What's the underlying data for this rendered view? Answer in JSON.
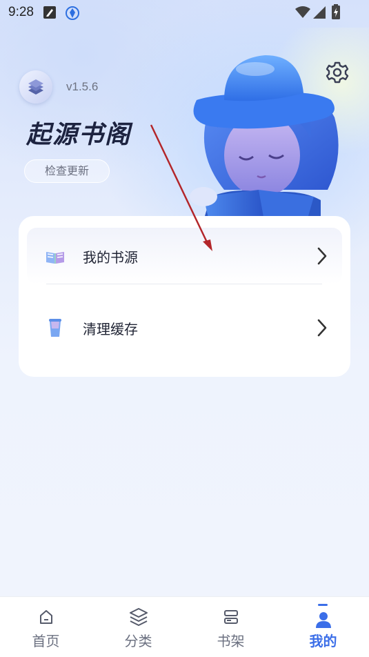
{
  "status_bar": {
    "time": "9:28",
    "icons": [
      "edit-note-icon",
      "security-shield-icon",
      "wifi-icon",
      "signal-icon",
      "battery-charging-icon"
    ]
  },
  "header": {
    "logo_icon": "books-stack-icon",
    "version": "v1.5.6",
    "app_title": "起源书阁",
    "update_button": "检查更新",
    "settings_icon": "gear-icon",
    "mascot": "reading-character-illustration"
  },
  "menu": {
    "items": [
      {
        "label": "我的书源",
        "icon": "open-book-icon"
      },
      {
        "label": "清理缓存",
        "icon": "trash-bin-icon"
      }
    ]
  },
  "nav": {
    "items": [
      {
        "label": "首页",
        "icon": "home-icon",
        "active": false
      },
      {
        "label": "分类",
        "icon": "layers-icon",
        "active": false
      },
      {
        "label": "书架",
        "icon": "bookshelf-icon",
        "active": false
      },
      {
        "label": "我的",
        "icon": "user-icon",
        "active": true
      }
    ]
  },
  "colors": {
    "accent": "#3b6ee8",
    "annotation_arrow": "#b3262a"
  }
}
